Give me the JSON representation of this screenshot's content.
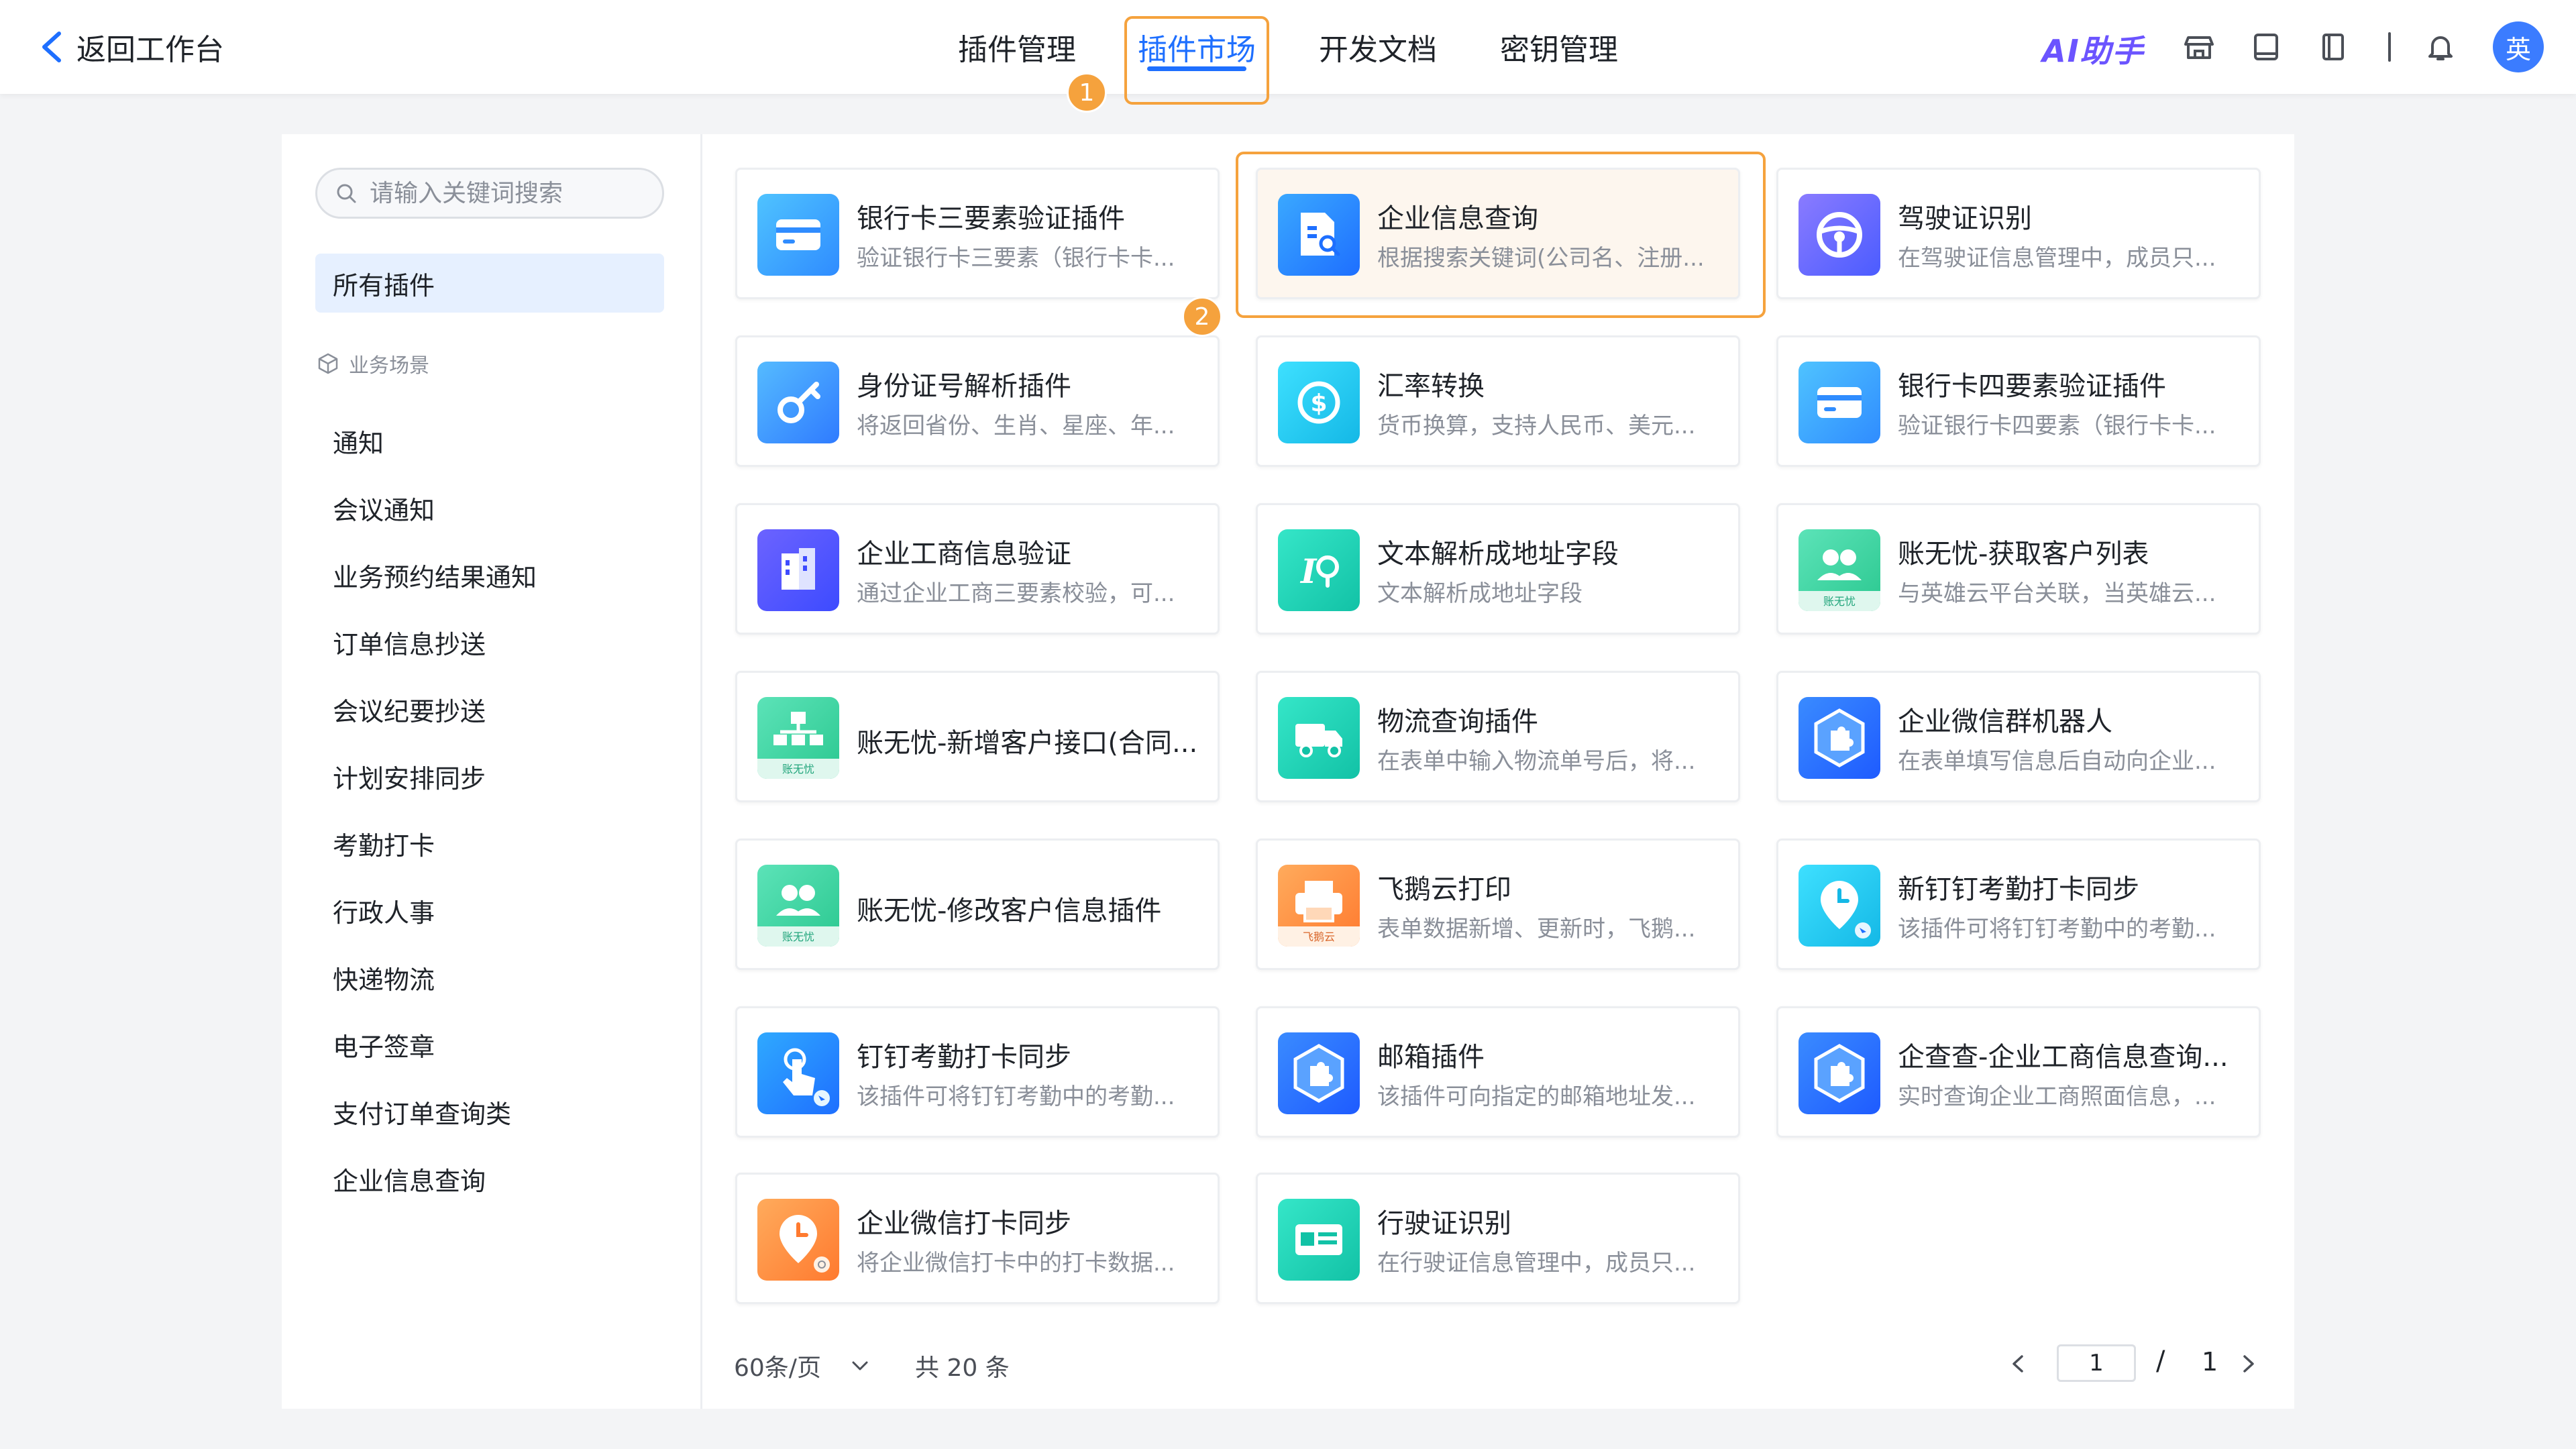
{
  "header": {
    "back_label": "返回工作台",
    "nav": [
      {
        "label": "插件管理",
        "active": false
      },
      {
        "label": "插件市场",
        "active": true
      },
      {
        "label": "开发文档",
        "active": false
      },
      {
        "label": "密钥管理",
        "active": false
      }
    ],
    "ai_label": "AI助手",
    "avatar_text": "英",
    "step1": "1",
    "step2": "2"
  },
  "sidebar": {
    "search_placeholder": "请输入关键词搜索",
    "all_label": "所有插件",
    "group_label": "业务场景",
    "items": [
      "通知",
      "会议通知",
      "业务预约结果通知",
      "订单信息抄送",
      "会议纪要抄送",
      "计划安排同步",
      "考勤打卡",
      "行政人事",
      "快递物流",
      "电子签章",
      "支付订单查询类",
      "企业信息查询"
    ]
  },
  "cards": [
    {
      "title": "银行卡三要素验证插件",
      "desc": "验证银行卡三要素（银行卡卡...",
      "icon": "bank-card-icon"
    },
    {
      "title": "企业信息查询",
      "desc": "根据搜索关键词(公司名、注册...",
      "icon": "company-search-icon"
    },
    {
      "title": "驾驶证识别",
      "desc": "在驾驶证信息管理中，成员只...",
      "icon": "steering-wheel-icon"
    },
    {
      "title": "身份证号解析插件",
      "desc": "将返回省份、生肖、星座、年...",
      "icon": "key-icon"
    },
    {
      "title": "汇率转换",
      "desc": "货币换算，支持人民币、美元...",
      "icon": "currency-exchange-icon"
    },
    {
      "title": "银行卡四要素验证插件",
      "desc": "验证银行卡四要素（银行卡卡...",
      "icon": "bank-card-icon"
    },
    {
      "title": "企业工商信息验证",
      "desc": "通过企业工商三要素校验，可...",
      "icon": "building-icon"
    },
    {
      "title": "文本解析成地址字段",
      "desc": "文本解析成地址字段",
      "icon": "location-text-icon"
    },
    {
      "title": "账无忧-获取客户列表",
      "desc": "与英雄云平台关联，当英雄云...",
      "icon": "users-icon"
    },
    {
      "title": "账无忧-新增客户接口(合同...",
      "desc": "",
      "icon": "org-chart-icon"
    },
    {
      "title": "物流查询插件",
      "desc": "在表单中输入物流单号后，将...",
      "icon": "truck-icon"
    },
    {
      "title": "企业微信群机器人",
      "desc": "在表单填写信息后自动向企业...",
      "icon": "puzzle-icon"
    },
    {
      "title": "账无忧-修改客户信息插件",
      "desc": "",
      "icon": "users-icon"
    },
    {
      "title": "飞鹅云打印",
      "desc": "表单数据新增、更新时，飞鹅...",
      "icon": "printer-icon"
    },
    {
      "title": "新钉钉考勤打卡同步",
      "desc": "该插件可将钉钉考勤中的考勤...",
      "icon": "clock-pin-icon"
    },
    {
      "title": "钉钉考勤打卡同步",
      "desc": "该插件可将钉钉考勤中的考勤...",
      "icon": "touch-icon"
    },
    {
      "title": "邮箱插件",
      "desc": "该插件可向指定的邮箱地址发...",
      "icon": "puzzle-icon"
    },
    {
      "title": "企查查-企业工商信息查询...",
      "desc": "实时查询企业工商照面信息，...",
      "icon": "puzzle-icon"
    },
    {
      "title": "企业微信打卡同步",
      "desc": "将企业微信打卡中的打卡数据...",
      "icon": "clock-pin-icon"
    },
    {
      "title": "行驶证识别",
      "desc": "在行驶证信息管理中，成员只...",
      "icon": "license-icon"
    }
  ],
  "card_badges": {
    "zwy": "账无忧",
    "fey": "飞鹅云"
  },
  "pagination": {
    "page_size": "60条/页",
    "total": "共 20 条",
    "current_page": "1",
    "separator": "/",
    "total_pages": "1"
  },
  "colors": {
    "accent": "#1e6fff",
    "highlight": "#f5a23d"
  }
}
